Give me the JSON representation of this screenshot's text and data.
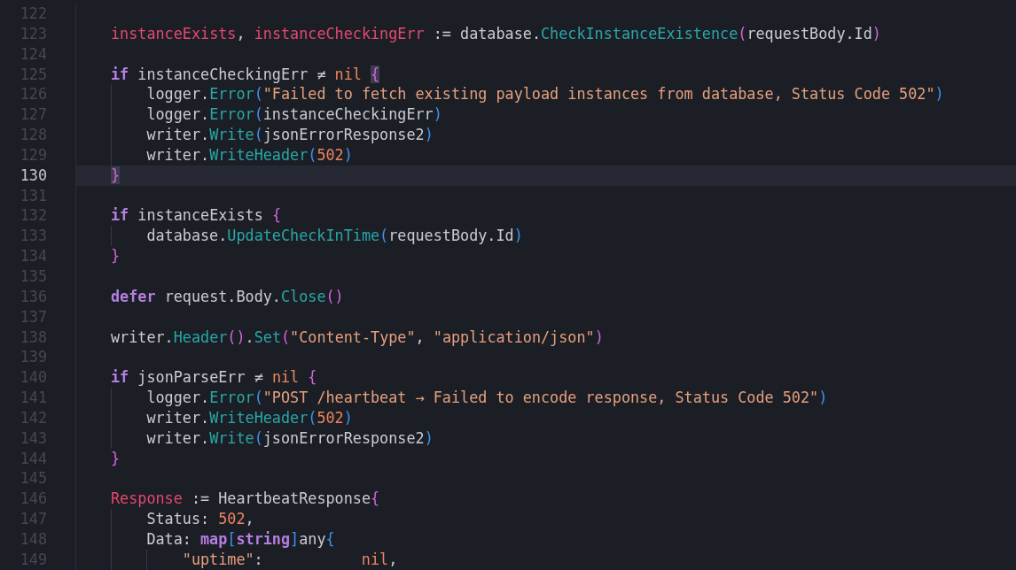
{
  "editor": {
    "lines": [
      {
        "number": "122",
        "current": false
      },
      {
        "number": "123",
        "current": false,
        "tokens": [
          {
            "kind": "var",
            "text": "instanceExists"
          },
          {
            "kind": "plain",
            "text": ", "
          },
          {
            "kind": "var",
            "text": "instanceCheckingErr"
          },
          {
            "kind": "plain",
            "text": " := database."
          },
          {
            "kind": "fn",
            "text": "CheckInstanceExistence"
          },
          {
            "kind": "b1",
            "text": "("
          },
          {
            "kind": "plain",
            "text": "requestBody.Id"
          },
          {
            "kind": "b1",
            "text": ")"
          }
        ]
      },
      {
        "number": "124",
        "current": false
      },
      {
        "number": "125",
        "current": false,
        "tokens": [
          {
            "kind": "kw",
            "text": "if"
          },
          {
            "kind": "plain",
            "text": " instanceCheckingErr ≠ "
          },
          {
            "kind": "lit",
            "text": "nil "
          },
          {
            "kind": "match",
            "text": "{"
          }
        ],
        "children": [
          {
            "number": "126",
            "current": false,
            "tokens": [
              {
                "kind": "plain",
                "text": "logger."
              },
              {
                "kind": "fn",
                "text": "Error"
              },
              {
                "kind": "b2",
                "text": "("
              },
              {
                "kind": "str",
                "text": "\"Failed to fetch existing payload instances from database, Status Code 502\""
              },
              {
                "kind": "b2",
                "text": ")"
              }
            ]
          },
          {
            "number": "127",
            "current": false,
            "tokens": [
              {
                "kind": "plain",
                "text": "logger."
              },
              {
                "kind": "fn",
                "text": "Error"
              },
              {
                "kind": "b2",
                "text": "("
              },
              {
                "kind": "plain",
                "text": "instanceCheckingErr"
              },
              {
                "kind": "b2",
                "text": ")"
              }
            ]
          },
          {
            "number": "128",
            "current": false,
            "tokens": [
              {
                "kind": "plain",
                "text": "writer."
              },
              {
                "kind": "fn",
                "text": "Write"
              },
              {
                "kind": "b2",
                "text": "("
              },
              {
                "kind": "plain",
                "text": "jsonErrorResponse2"
              },
              {
                "kind": "b2",
                "text": ")"
              }
            ]
          },
          {
            "number": "129",
            "current": false,
            "tokens": [
              {
                "kind": "plain",
                "text": "writer."
              },
              {
                "kind": "fn",
                "text": "WriteHeader"
              },
              {
                "kind": "b2",
                "text": "("
              },
              {
                "kind": "lit",
                "text": "502"
              },
              {
                "kind": "b2",
                "text": ")"
              }
            ]
          }
        ]
      },
      {
        "number": "130",
        "current": true,
        "tokens": [
          {
            "kind": "match",
            "text": "}"
          }
        ]
      },
      {
        "number": "131",
        "current": false
      },
      {
        "number": "132",
        "current": false,
        "tokens": [
          {
            "kind": "kw",
            "text": "if"
          },
          {
            "kind": "plain",
            "text": " instanceExists "
          },
          {
            "kind": "b1",
            "text": "{"
          }
        ],
        "children": [
          {
            "number": "133",
            "current": false,
            "tokens": [
              {
                "kind": "plain",
                "text": "database."
              },
              {
                "kind": "fn",
                "text": "UpdateCheckInTime"
              },
              {
                "kind": "b2",
                "text": "("
              },
              {
                "kind": "plain",
                "text": "requestBody.Id"
              },
              {
                "kind": "b2",
                "text": ")"
              }
            ]
          }
        ]
      },
      {
        "number": "134",
        "current": false,
        "tokens": [
          {
            "kind": "b1",
            "text": "}"
          }
        ]
      },
      {
        "number": "135",
        "current": false
      },
      {
        "number": "136",
        "current": false,
        "tokens": [
          {
            "kind": "kw",
            "text": "defer"
          },
          {
            "kind": "plain",
            "text": " request.Body."
          },
          {
            "kind": "fn",
            "text": "Close"
          },
          {
            "kind": "b1",
            "text": "()"
          }
        ]
      },
      {
        "number": "137",
        "current": false
      },
      {
        "number": "138",
        "current": false,
        "tokens": [
          {
            "kind": "plain",
            "text": "writer."
          },
          {
            "kind": "fn",
            "text": "Header"
          },
          {
            "kind": "b1",
            "text": "()"
          },
          {
            "kind": "plain",
            "text": "."
          },
          {
            "kind": "fn",
            "text": "Set"
          },
          {
            "kind": "b1",
            "text": "("
          },
          {
            "kind": "str",
            "text": "\"Content-Type\""
          },
          {
            "kind": "plain",
            "text": ", "
          },
          {
            "kind": "str",
            "text": "\"application/json\""
          },
          {
            "kind": "b1",
            "text": ")"
          }
        ]
      },
      {
        "number": "139",
        "current": false
      },
      {
        "number": "140",
        "current": false,
        "tokens": [
          {
            "kind": "kw",
            "text": "if"
          },
          {
            "kind": "plain",
            "text": " jsonParseErr ≠ "
          },
          {
            "kind": "lit",
            "text": "nil "
          },
          {
            "kind": "b1",
            "text": "{"
          }
        ],
        "children": [
          {
            "number": "141",
            "current": false,
            "tokens": [
              {
                "kind": "plain",
                "text": "logger."
              },
              {
                "kind": "fn",
                "text": "Error"
              },
              {
                "kind": "b2",
                "text": "("
              },
              {
                "kind": "str",
                "text": "\"POST /heartbeat → Failed to encode response, Status Code 502\""
              },
              {
                "kind": "b2",
                "text": ")"
              }
            ]
          },
          {
            "number": "142",
            "current": false,
            "tokens": [
              {
                "kind": "plain",
                "text": "writer."
              },
              {
                "kind": "fn",
                "text": "WriteHeader"
              },
              {
                "kind": "b2",
                "text": "("
              },
              {
                "kind": "lit",
                "text": "502"
              },
              {
                "kind": "b2",
                "text": ")"
              }
            ]
          },
          {
            "number": "143",
            "current": false,
            "tokens": [
              {
                "kind": "plain",
                "text": "writer."
              },
              {
                "kind": "fn",
                "text": "Write"
              },
              {
                "kind": "b2",
                "text": "("
              },
              {
                "kind": "plain",
                "text": "jsonErrorResponse2"
              },
              {
                "kind": "b2",
                "text": ")"
              }
            ]
          }
        ]
      },
      {
        "number": "144",
        "current": false,
        "tokens": [
          {
            "kind": "b1",
            "text": "}"
          }
        ]
      },
      {
        "number": "145",
        "current": false
      },
      {
        "number": "146",
        "current": false,
        "tokens": [
          {
            "kind": "var",
            "text": "Response"
          },
          {
            "kind": "plain",
            "text": " := HeartbeatResponse"
          },
          {
            "kind": "b1",
            "text": "{"
          }
        ],
        "children": [
          {
            "number": "147",
            "current": false,
            "tokens": [
              {
                "kind": "plain",
                "text": "Status: "
              },
              {
                "kind": "lit",
                "text": "502"
              },
              {
                "kind": "plain",
                "text": ","
              }
            ]
          },
          {
            "number": "148",
            "current": false,
            "tokens": [
              {
                "kind": "plain",
                "text": "Data: "
              },
              {
                "kind": "kw",
                "text": "map"
              },
              {
                "kind": "b2",
                "text": "["
              },
              {
                "kind": "kw",
                "text": "string"
              },
              {
                "kind": "b2",
                "text": "]"
              },
              {
                "kind": "plain",
                "text": "any"
              },
              {
                "kind": "b2",
                "text": "{"
              }
            ],
            "children": [
              {
                "number": "149",
                "current": false,
                "tokens": [
                  {
                    "kind": "str",
                    "text": "\"uptime\""
                  },
                  {
                    "kind": "plain",
                    "text": ":           "
                  },
                  {
                    "kind": "lit",
                    "text": "nil"
                  },
                  {
                    "kind": "plain",
                    "text": ","
                  }
                ]
              }
            ]
          }
        ]
      }
    ]
  }
}
